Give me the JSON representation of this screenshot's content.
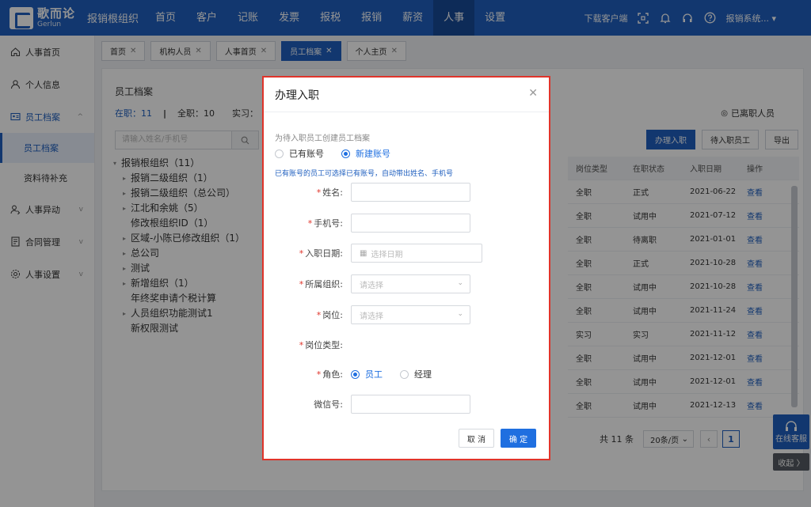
{
  "app": {
    "logo_cn": "歌而论",
    "logo_en": "Gerlun",
    "org_name": "报销根组织"
  },
  "topnav": [
    "首页",
    "客户",
    "记账",
    "发票",
    "报税",
    "报销",
    "薪资",
    "人事",
    "设置"
  ],
  "topnav_active": "人事",
  "topright": {
    "download": "下载客户端",
    "user": "报销系统..."
  },
  "sidebar": {
    "items": [
      {
        "label": "人事首页",
        "icon": "home-icon"
      },
      {
        "label": "个人信息",
        "icon": "user-icon"
      },
      {
        "label": "员工档案",
        "icon": "id-card-icon",
        "chev": "^"
      },
      {
        "label": "人事异动",
        "icon": "user-transfer-icon",
        "chev": "v"
      },
      {
        "label": "合同管理",
        "icon": "contract-icon",
        "chev": "v"
      },
      {
        "label": "人事设置",
        "icon": "gear-icon",
        "chev": "v"
      }
    ],
    "sub": [
      "员工档案",
      "资料待补充"
    ]
  },
  "tabs": [
    {
      "label": "首页",
      "x": "✕"
    },
    {
      "label": "机构人员",
      "x": "✕"
    },
    {
      "label": "人事首页",
      "x": "✕"
    },
    {
      "label": "员工档案",
      "x": "✕"
    },
    {
      "label": "个人主页",
      "x": "✕"
    }
  ],
  "panel": {
    "title": "员工档案",
    "stat_active": "在职：11",
    "stat_fulltime": "全职：10",
    "stat_intern": "实习：",
    "resigned": "已离职人员",
    "search_placeholder": "请输入姓名/手机号",
    "buttons": [
      "办理入职",
      "待入职员工",
      "导出"
    ]
  },
  "tree": [
    {
      "label": "报销根组织（11）",
      "arrow": "▾",
      "level": 0
    },
    {
      "label": "报销二级组织（1）",
      "arrow": "▸",
      "level": 1
    },
    {
      "label": "报销二级组织（总公司）",
      "arrow": "▸",
      "level": 1
    },
    {
      "label": "江北和余姚（5）",
      "arrow": "▸",
      "level": 1
    },
    {
      "label": "修改根组织ID（1）",
      "arrow": "",
      "level": 2
    },
    {
      "label": "区域-小陈已修改组织（1）",
      "arrow": "▸",
      "level": 1
    },
    {
      "label": "总公司",
      "arrow": "▸",
      "level": 1
    },
    {
      "label": "测试",
      "arrow": "▸",
      "level": 1
    },
    {
      "label": "新增组织（1）",
      "arrow": "▸",
      "level": 1
    },
    {
      "label": "年终奖申请个税计算",
      "arrow": "",
      "level": 2
    },
    {
      "label": "人员组织功能测试1",
      "arrow": "▸",
      "level": 1
    },
    {
      "label": "新权限测试",
      "arrow": "",
      "level": 2
    }
  ],
  "table": {
    "headers": [
      "岗位类型",
      "在职状态",
      "入职日期",
      "操作"
    ],
    "rows": [
      [
        "全职",
        "正式",
        "2021-06-22",
        "查看"
      ],
      [
        "全职",
        "试用中",
        "2021-07-12",
        "查看"
      ],
      [
        "全职",
        "待离职",
        "2021-01-01",
        "查看"
      ],
      [
        "全职",
        "正式",
        "2021-10-28",
        "查看"
      ],
      [
        "全职",
        "试用中",
        "2021-10-28",
        "查看"
      ],
      [
        "全职",
        "试用中",
        "2021-11-24",
        "查看"
      ],
      [
        "实习",
        "实习",
        "2021-11-12",
        "查看"
      ],
      [
        "全职",
        "试用中",
        "2021-12-01",
        "查看"
      ],
      [
        "全职",
        "试用中",
        "2021-12-01",
        "查看"
      ],
      [
        "全职",
        "试用中",
        "2021-12-13",
        "查看"
      ]
    ]
  },
  "pager": {
    "total": "共 11 条",
    "size": "20条/页",
    "page": "1"
  },
  "service": {
    "label": "在线客服",
    "collapse": "收起 〉"
  },
  "modal": {
    "title": "办理入职",
    "desc": "为待入职员工创建员工档案",
    "radio_existing": "已有账号",
    "radio_new": "新建账号",
    "note": "已有账号的员工可选择已有账号，自动带出姓名、手机号",
    "fields": {
      "name": "姓名:",
      "phone": "手机号:",
      "date": "入职日期:",
      "date_placeholder": "选择日期",
      "org": "所属组织:",
      "org_placeholder": "请选择",
      "post": "岗位:",
      "post_placeholder": "请选择",
      "post_type": "岗位类型:",
      "role": "角色:",
      "role_employee": "员工",
      "role_manager": "经理",
      "wechat": "微信号:"
    },
    "cancel": "取 消",
    "confirm": "确 定"
  }
}
